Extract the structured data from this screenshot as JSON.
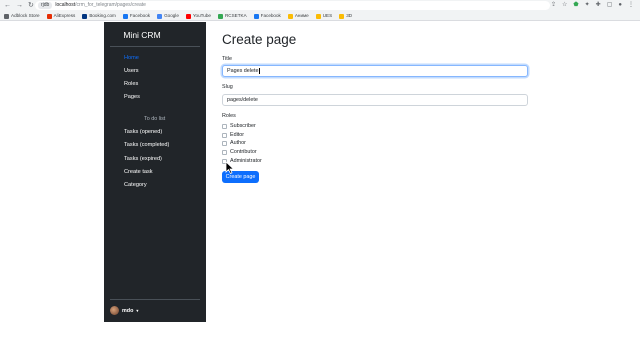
{
  "browser": {
    "nav_glyphs": [
      "←",
      "→",
      "↻"
    ],
    "url_badge": "rjdb",
    "url_host": "localhost",
    "url_path": "/crm_for_telegram/pages/create",
    "bookmarks": [
      {
        "label": "Adblock Store",
        "color": "#5f6368"
      },
      {
        "label": "AliExpress",
        "color": "#e62e04"
      },
      {
        "label": "Booking.com",
        "color": "#003580"
      },
      {
        "label": "Facebook",
        "color": "#1877f2"
      },
      {
        "label": "Google",
        "color": "#4285f4"
      },
      {
        "label": "YouTube",
        "color": "#ff0000"
      },
      {
        "label": "RCSETKA",
        "color": "#34a853"
      },
      {
        "label": "Facebook",
        "color": "#1877f2"
      },
      {
        "label": "Аниме",
        "color": "#fbbc04"
      },
      {
        "label": "UES",
        "color": "#fbbc04"
      },
      {
        "label": "3D",
        "color": "#fbbc04"
      }
    ]
  },
  "sidebar": {
    "brand": "Mini CRM",
    "items": [
      {
        "label": "Home",
        "active": true
      },
      {
        "label": "Users"
      },
      {
        "label": "Roles"
      },
      {
        "label": "Pages"
      }
    ],
    "todo_header": "To do list",
    "todo_items": [
      {
        "label": "Tasks (opened)"
      },
      {
        "label": "Tasks (completed)"
      },
      {
        "label": "Tasks (expired)"
      },
      {
        "label": "Create task"
      },
      {
        "label": "Category"
      }
    ],
    "user": {
      "name": "mdo",
      "caret": "▾"
    }
  },
  "main": {
    "title": "Create page",
    "title_label": "Title",
    "title_value": "Pages delete",
    "slug_label": "Slug",
    "slug_value": "pages/delete",
    "roles_label": "Roles",
    "roles": [
      "Subscriber",
      "Editor",
      "Author",
      "Contributor",
      "Administrator"
    ],
    "submit_label": "Create page"
  },
  "colors": {
    "sidebar_bg": "#212529",
    "accent": "#0d6efd"
  }
}
